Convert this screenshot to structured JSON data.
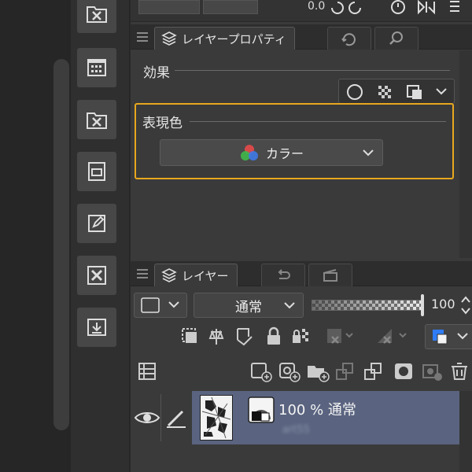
{
  "top_strip": {
    "value": "0.0"
  },
  "property_panel": {
    "tab_label": "レイヤープロパティ",
    "effect_label": "効果",
    "expression_color_label": "表現色",
    "expression_color_value": "カラー"
  },
  "layer_panel": {
    "tab_label": "レイヤー",
    "blend_mode": "通常",
    "opacity": "100",
    "layer": {
      "opacity_mode": "100 % 通常",
      "name": "art55"
    }
  },
  "colors": {
    "highlight": "#e8a71e",
    "selected_layer": "#5a6480",
    "accent_blue": "#2f7cf6"
  },
  "icons": [
    "tool-icons",
    "eye-icon",
    "pen-icon",
    "lock-icon",
    "new-layer-icon",
    "trash-icon"
  ]
}
